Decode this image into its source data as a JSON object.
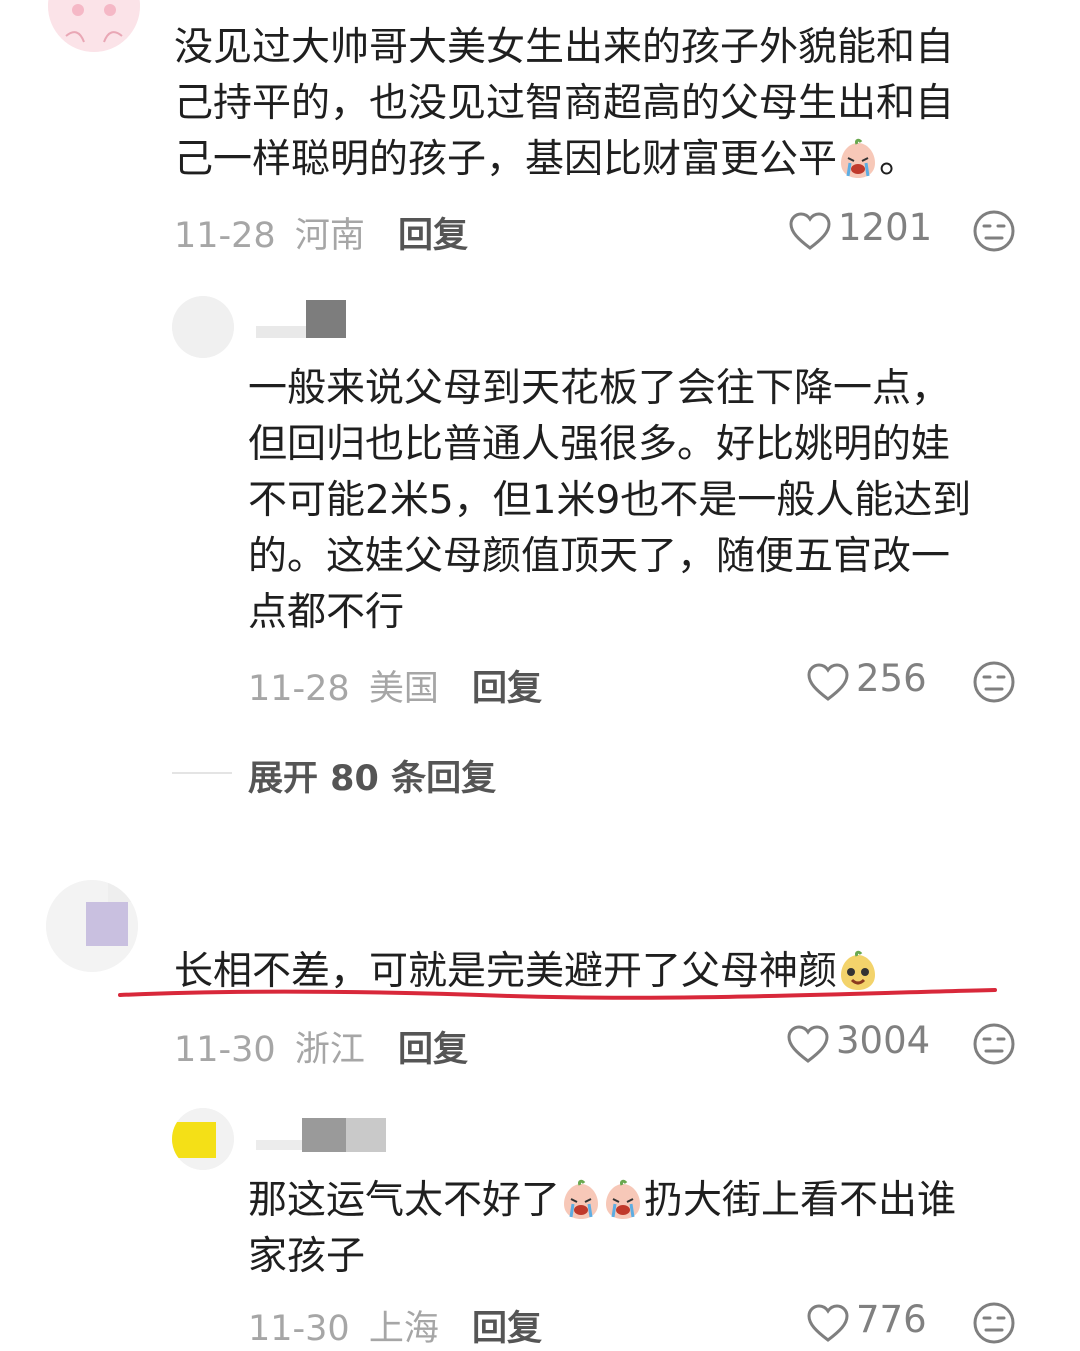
{
  "comments": [
    {
      "text_lines": [
        "没见过大帅哥大美女生出来的孩子外貌能和自",
        "己持平的，也没见过智商超高的父母生出和自",
        "己一样聪明的孩子，基因比财富更公平",
        "。"
      ],
      "date": "11-28",
      "location": "河南",
      "reply_label": "回复",
      "likes": "1201",
      "emoji": "crying-peach-emoji"
    },
    {
      "text_lines": [
        "一般来说父母到天花板了会往下降一点，",
        "但回归也比普通人强很多。好比姚明的娃",
        "不可能2米5，但1米9也不是一般人能达到",
        "的。这娃父母颜值顶天了，随便五官改一",
        "点都不行"
      ],
      "date": "11-28",
      "location": "美国",
      "reply_label": "回复",
      "likes": "256"
    },
    {
      "expand_label": "展开 80 条回复"
    },
    {
      "text": "长相不差，可就是完美避开了父母神颜",
      "date": "11-30",
      "location": "浙江",
      "reply_label": "回复",
      "likes": "3004",
      "emoji": "smiling-peach-emoji"
    },
    {
      "text_lines": [
        "那这运气太不好了",
        "扔大街上看不出谁",
        "家孩子"
      ],
      "date": "11-30",
      "location": "上海",
      "reply_label": "回复",
      "likes": "776",
      "emoji": "crying-peach-emoji"
    }
  ],
  "colors": {
    "underline": "#d8283a",
    "meta": "#a6a6a6",
    "text": "#1f1f1f"
  }
}
